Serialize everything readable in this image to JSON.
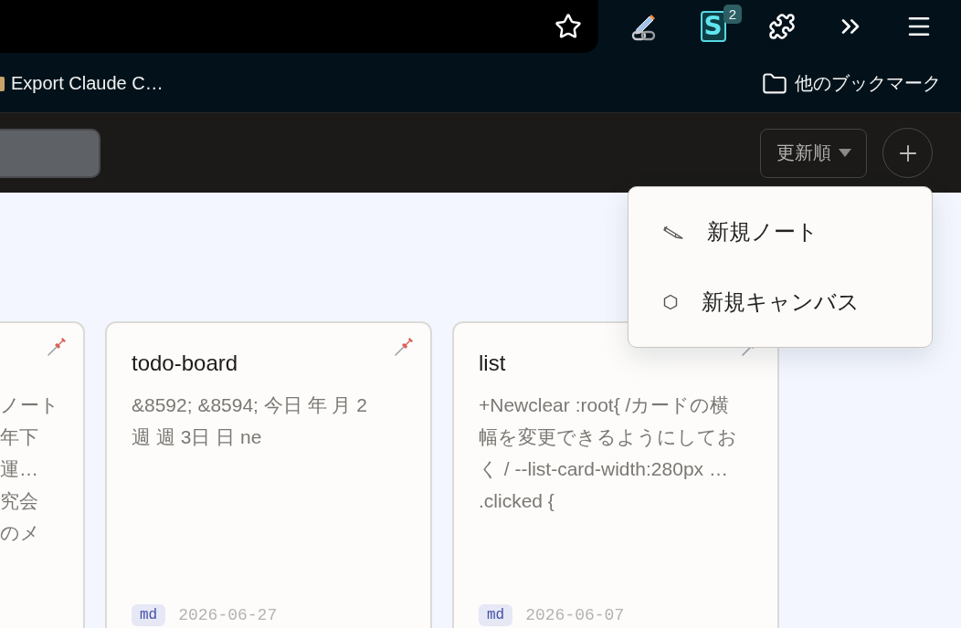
{
  "browser_toolbar": {
    "extensions": [
      {
        "kind": "pencil-link"
      },
      {
        "kind": "letter-tile",
        "letter": "S",
        "badge": "2"
      },
      {
        "kind": "puzzle"
      }
    ]
  },
  "bookmarks_bar": {
    "items": [
      {
        "label": "Export Claude C…"
      }
    ],
    "other_bookmarks": {
      "label": "他のブックマーク"
    }
  },
  "app_toolbar": {
    "sort_select": {
      "value": "更新順"
    },
    "add_menu": {
      "expanded": true,
      "items": [
        {
          "kind": "note",
          "label": "新規ノート"
        },
        {
          "kind": "canvas",
          "label": "新規キャンバス"
        }
      ]
    }
  },
  "cards": [
    {
      "kind": "clipped",
      "pinned": true,
      "excerpt_lines": [
        "ノート",
        "年下",
        "運…",
        "究会",
        "のメ"
      ]
    },
    {
      "kind": "full",
      "pinned": true,
      "title": "todo-board",
      "excerpt_lines": [
        "&8592; &8594; 今日 年 月 2",
        "週 週 3日 日 ne"
      ],
      "format": "md",
      "date": "2026-06-27"
    },
    {
      "kind": "full",
      "pinned": true,
      "title": "list",
      "excerpt_lines": [
        "+Newclear :root{ /カードの横",
        "幅を変更できるようにしてお",
        "く / --list-card-width:280px …",
        ".clicked {"
      ],
      "format": "md",
      "date": "2026-06-07"
    }
  ]
}
